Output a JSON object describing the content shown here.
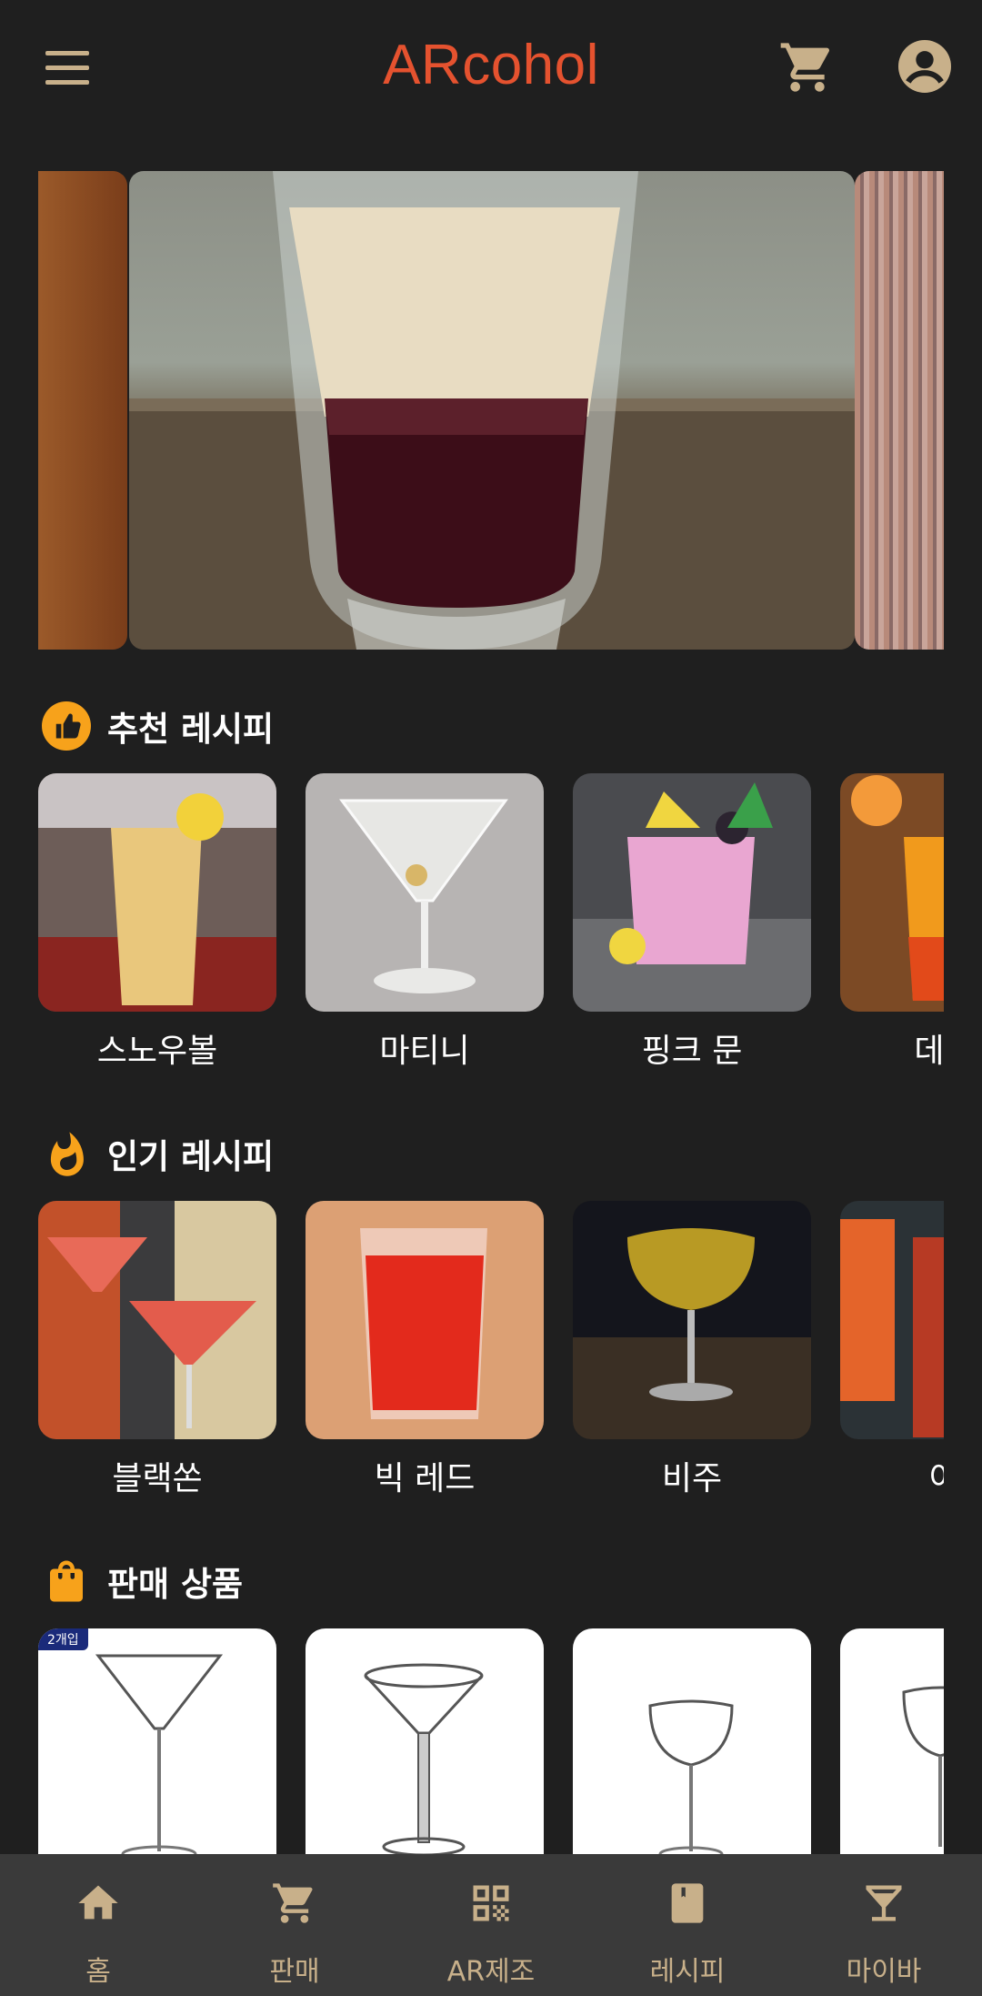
{
  "app": {
    "title": "ARcohol"
  },
  "sections": {
    "recommended": {
      "title": "추천 레시피",
      "items": [
        {
          "name": "스노우볼"
        },
        {
          "name": "마티니"
        },
        {
          "name": "핑크 문"
        },
        {
          "name": "데킬라"
        }
      ]
    },
    "popular": {
      "title": "인기 레시피",
      "items": [
        {
          "name": "블랙쏜"
        },
        {
          "name": "빅 레드"
        },
        {
          "name": "비주"
        },
        {
          "name": "아메"
        }
      ]
    },
    "products": {
      "title": "판매 상품",
      "badge": "2개입"
    }
  },
  "nav": [
    {
      "label": "홈",
      "icon": "home-icon"
    },
    {
      "label": "판매",
      "icon": "cart-icon"
    },
    {
      "label": "AR제조",
      "icon": "qr-code-icon"
    },
    {
      "label": "레시피",
      "icon": "book-icon"
    },
    {
      "label": "마이바",
      "icon": "cocktail-glass-icon"
    }
  ],
  "colors": {
    "accent": "#e5522f",
    "icon_tan": "#c8b08a",
    "section_icon": "#f7a21b",
    "background": "#1f1f1f",
    "nav_bg": "#3a3a3a"
  }
}
